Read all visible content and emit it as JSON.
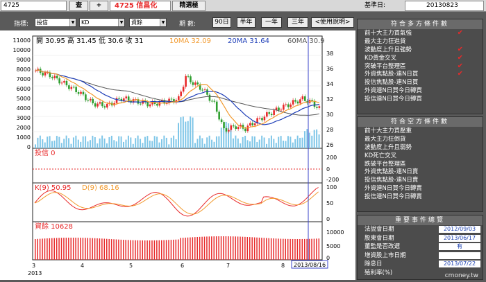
{
  "topbar": {
    "stock_code": "4725",
    "query_label": "查",
    "add_label": "+",
    "stock_name": "4725 信昌化",
    "mode_label": "精選極",
    "base_date_label": "基準日:",
    "base_date": "20130823"
  },
  "controls": {
    "indicator_label": "指標:",
    "indicator_select": "投信",
    "kd_select": "KD",
    "finance_select": "資餘",
    "period_label": "期  數:",
    "periods": [
      "90日",
      "半年",
      "一年",
      "三年"
    ],
    "help_label": "<使用說明>"
  },
  "chart": {
    "price_header": "開 30.95 高 31.45 低 30.6 收 31",
    "ma10": "10MA 32.09",
    "ma20": "20MA 31.64",
    "ma60": "60MA 30.9",
    "left_ticks": [
      "11000",
      "10000",
      "9000",
      "8000",
      "7000",
      "6000",
      "5000",
      "4000",
      "3000",
      "2000",
      "1000",
      "0"
    ],
    "right_ticks": [
      "38",
      "36",
      "34",
      "32",
      "30",
      "28",
      "26"
    ],
    "inv_label": "投信 0",
    "inv_ticks": [
      "200",
      "0",
      "-200"
    ],
    "kd_k": "K(9) 50.95",
    "kd_d": "D(9) 68.16",
    "kd_ticks": [
      "100",
      "50",
      "0"
    ],
    "fin_label": "資餘 10628",
    "fin_ticks": [
      "10000",
      "5000",
      "0"
    ],
    "months": [
      "3",
      "4",
      "5",
      "6",
      "7",
      "8"
    ],
    "year": "2013",
    "cursor_date": "2013/08/16",
    "colors": {
      "up": "#e8292a",
      "down": "#2e9e2e",
      "ma10": "#f29a2e",
      "ma20": "#1f3fb8",
      "ma60": "#555555",
      "volume": "#7fc6e8",
      "cursor": "#3a43c8"
    }
  },
  "bull_panel": {
    "title": "符合多方條件數",
    "items": [
      {
        "label": "前十大主力買氣強",
        "checked": true
      },
      {
        "label": "最大主力狂進貨",
        "checked": false
      },
      {
        "label": "波動度上升且強勢",
        "checked": true
      },
      {
        "label": "KD黃金交叉",
        "checked": true
      },
      {
        "label": "突破平台整理區",
        "checked": true
      },
      {
        "label": "外資焦點股-連N日買",
        "checked": true
      },
      {
        "label": "投信焦點股-連N日買",
        "checked": false
      },
      {
        "label": "外資連N日買今日轉買",
        "checked": false
      },
      {
        "label": "投信連N日買今日轉買",
        "checked": false
      }
    ],
    "check_glyph": "✔"
  },
  "bear_panel": {
    "title": "符合空方條件數",
    "items": [
      "前十大主力買壓重",
      "最大主力狂倒貨",
      "波動度上升且弱勢",
      "KD死亡交叉",
      "跌破平台整理區",
      "外資焦點股-連N日賣",
      "投信焦點股-連N日賣",
      "外資連N日買今日轉賣",
      "投信連N日買今日轉賣"
    ]
  },
  "events_panel": {
    "title": "重要事件總覽",
    "items": [
      {
        "label": "法說會日期",
        "value": "2012/09/03"
      },
      {
        "label": "股東會日期",
        "value": "2013/06/17"
      },
      {
        "label": "董監是否改選",
        "value": "有"
      },
      {
        "label": "增資股上市日期",
        "value": ""
      },
      {
        "label": "除息日",
        "value": "2013/07/22"
      },
      {
        "label": "殖利率(%)",
        "value": ""
      }
    ]
  },
  "watermark": "cmoney.tw"
}
